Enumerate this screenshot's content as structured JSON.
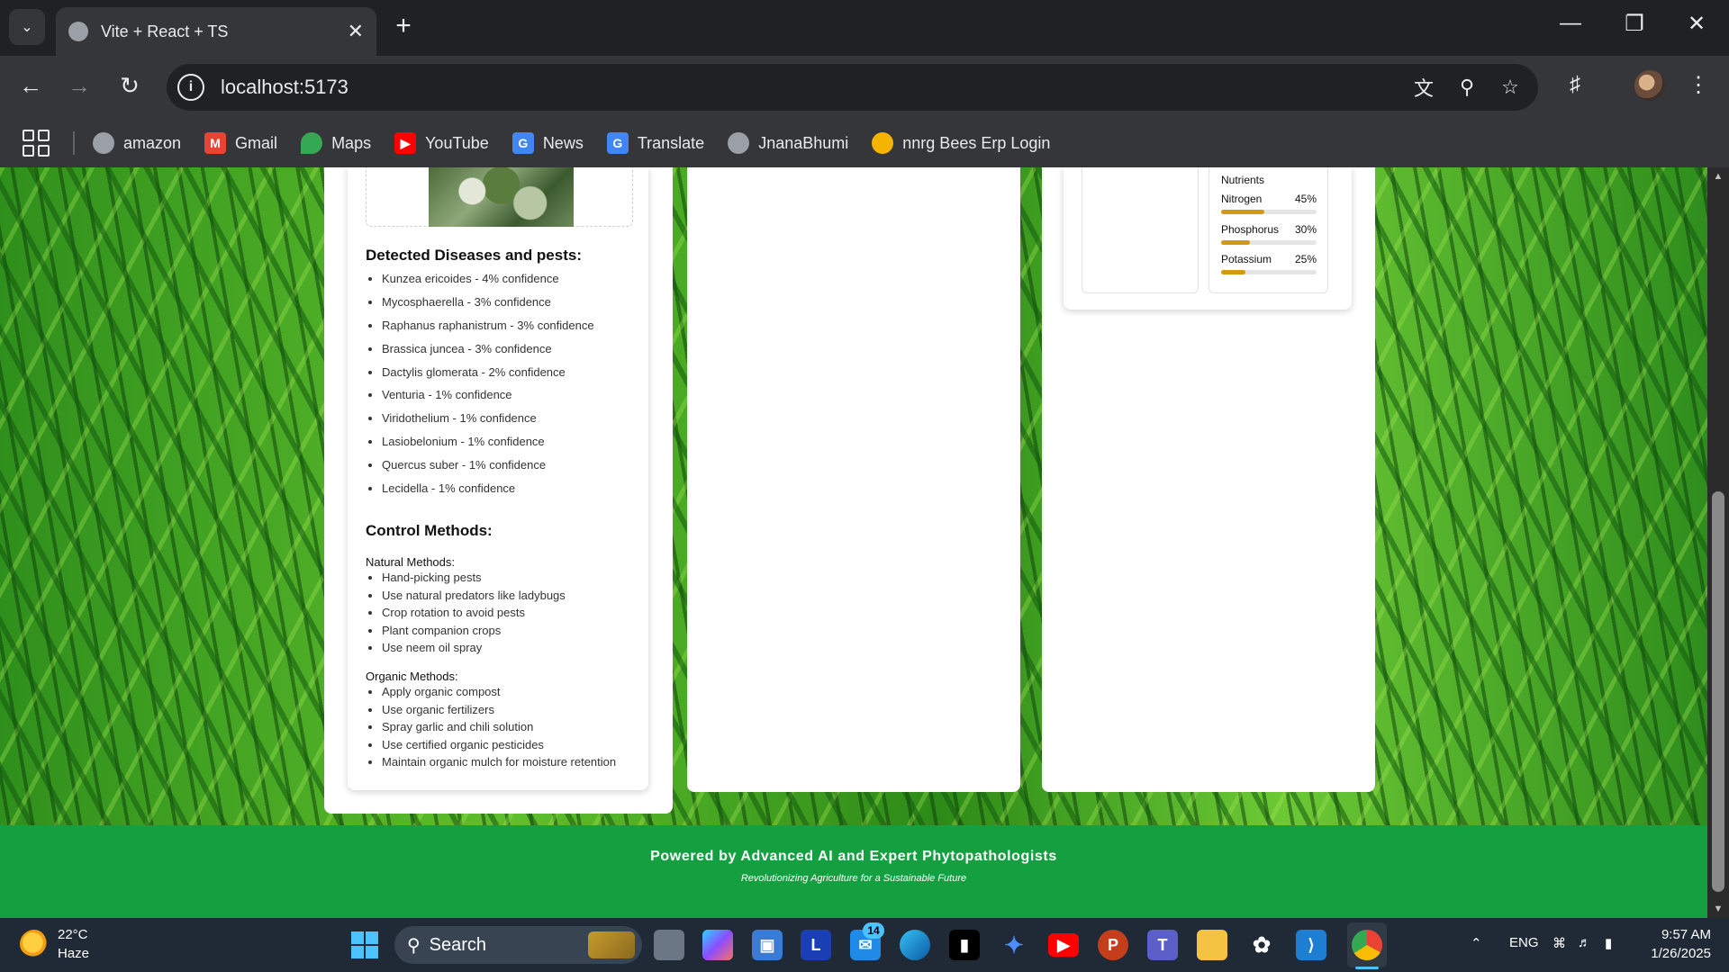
{
  "browser": {
    "tab_title": "Vite + React + TS",
    "url": "localhost:5173",
    "bookmarks": [
      "amazon",
      "Gmail",
      "Maps",
      "YouTube",
      "News",
      "Translate",
      "JnanaBhumi",
      "nnrg Bees Erp Login"
    ]
  },
  "page": {
    "diseases_heading": "Detected Diseases and pests:",
    "diseases": [
      "Kunzea ericoides - 4% confidence",
      "Mycosphaerella - 3% confidence",
      "Raphanus raphanistrum - 3% confidence",
      "Brassica juncea - 3% confidence",
      "Dactylis glomerata - 2% confidence",
      "Venturia - 1% confidence",
      "Viridothelium - 1% confidence",
      "Lasiobelonium - 1% confidence",
      "Quercus suber - 1% confidence",
      "Lecidella - 1% confidence"
    ],
    "control_heading": "Control Methods:",
    "natural_label": "Natural Methods:",
    "natural_methods": [
      "Hand-picking pests",
      "Use natural predators like ladybugs",
      "Crop rotation to avoid pests",
      "Plant companion crops",
      "Use neem oil spray"
    ],
    "organic_label": "Organic Methods:",
    "organic_methods": [
      "Apply organic compost",
      "Use organic fertilizers",
      "Spray garlic and chili solution",
      "Use certified organic pesticides",
      "Maintain organic mulch for moisture retention"
    ],
    "nutrients": {
      "title": "Nutrients",
      "items": [
        {
          "name": "Nitrogen",
          "percent_label": "45%",
          "value": 45
        },
        {
          "name": "Phosphorus",
          "percent_label": "30%",
          "value": 30
        },
        {
          "name": "Potassium",
          "percent_label": "25%",
          "value": 25
        }
      ],
      "bar_color": "#d19a12"
    },
    "footer_title": "Powered by Advanced AI and Expert Phytopathologists",
    "footer_subtitle": "Revolutionizing Agriculture for a Sustainable Future",
    "footer_color": "#14a040"
  },
  "taskbar": {
    "weather_temp": "22°C",
    "weather_cond": "Haze",
    "search_label": "Search",
    "mail_badge": "14",
    "language": "ENG",
    "time": "9:57 AM",
    "date": "1/26/2025"
  }
}
